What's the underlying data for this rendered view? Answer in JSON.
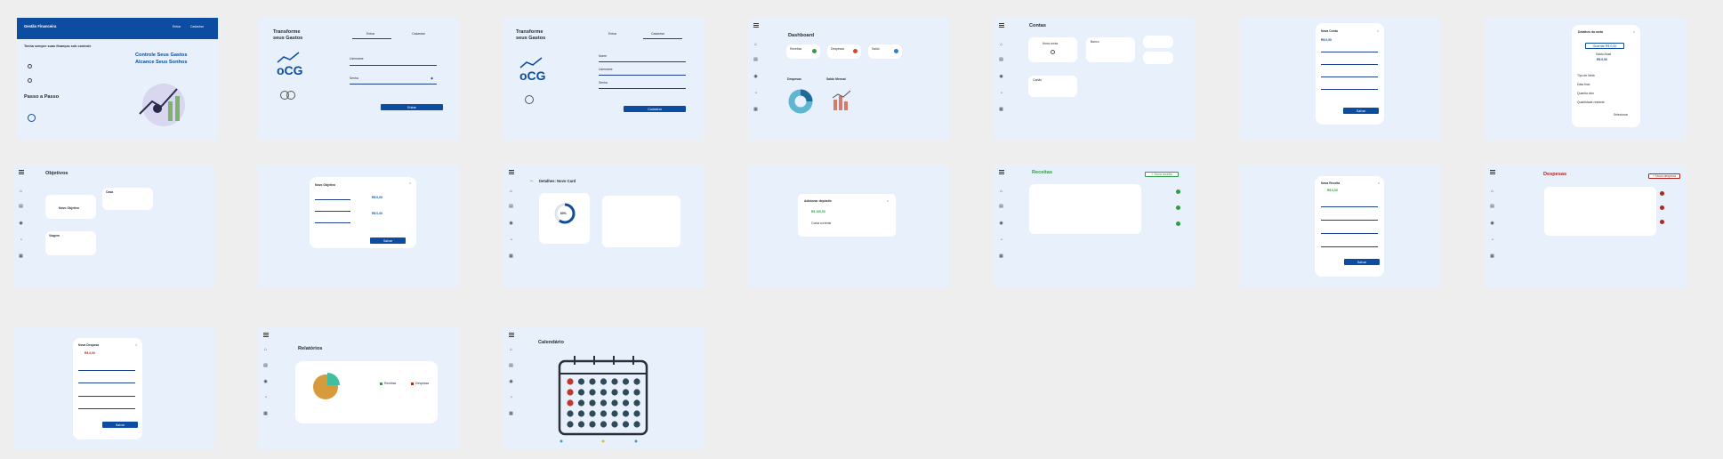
{
  "frames": {
    "landing": {
      "brand": "Gestão Financeira",
      "nav_enter": "Entrar",
      "nav_register": "Cadastrar",
      "intro": "Tenha sempre suas finanças sob controle",
      "steps_title": "Passo a Passo",
      "hero_title_1": "Controle Seus Gastos",
      "hero_title_2": "Alcance Seus Sonhos"
    },
    "login": {
      "heading_1": "Transforme",
      "heading_2": "seus Gastos",
      "tab_enter": "Entrar",
      "tab_register": "Cadastrar",
      "username_label": "Username",
      "password_label": "Senha",
      "submit": "Entrar"
    },
    "register": {
      "heading_1": "Transforme",
      "heading_2": "seus Gastos",
      "tab_enter": "Entrar",
      "tab_register": "Cadastrar",
      "name_label": "Nome",
      "username_label": "Username",
      "password_label": "Senha",
      "submit": "Cadastrar"
    },
    "dashboard": {
      "title": "Dashboard",
      "card_1": "Receitas",
      "card_2": "Despesas",
      "card_3": "Saldo",
      "section_charts": "Despesas",
      "section_month": "Saldo Mensal"
    },
    "accounts": {
      "title": "Contas",
      "new_account": "Nova conta",
      "bank": "Banco",
      "card": "Cartão"
    },
    "new_account_modal": {
      "title": "Nova Conta",
      "value": "R$ 0,00",
      "submit": "Salvar"
    },
    "goal_details": {
      "title": "Detalhes da meta",
      "add_button": "Guardar R$ 0,00",
      "saved_label": "Saldo Atual",
      "saved_value": "R$ 0,00",
      "type_label": "Tipo de Meta",
      "end_label": "Data final",
      "amount_label": "Quantia alvo",
      "remaining_label": "Quantidade restante",
      "footer": "Selecionar"
    },
    "goals": {
      "title": "Objetivos",
      "new_goal": "Novo Objetivo",
      "goal_1": "Viagem",
      "goal_2": "Casa"
    },
    "new_goal_modal": {
      "title": "Novo Objetivo",
      "value_1": "R$ 0,00",
      "value_2": "R$ 0,00",
      "submit": "Salvar"
    },
    "card_details": {
      "title": "Detalhes: Novo Card",
      "percent": "60%"
    },
    "deposit_modal": {
      "title": "Adicionar depósito",
      "value": "R$ 100,00",
      "account": "Conta corrente"
    },
    "income": {
      "title": "Receitas",
      "add": "+ Nova receita"
    },
    "new_income_modal": {
      "title": "Nova Receita",
      "value": "R$ 0,00",
      "submit": "Salvar"
    },
    "expenses": {
      "title": "Despesas",
      "add": "+ Nova despesa"
    },
    "new_expense_modal": {
      "title": "Nova Despesa",
      "value": "R$ 0,00",
      "submit": "Salvar"
    },
    "reports": {
      "title": "Relatórios",
      "legend_1": "Receitas",
      "legend_2": "Despesas"
    },
    "calendar": {
      "title": "Calendário"
    }
  },
  "colors": {
    "primary": "#0d4da1",
    "background": "#e8f0fb",
    "page": "#eeeeee",
    "income": "#2e9d43",
    "expense": "#b3261e"
  }
}
